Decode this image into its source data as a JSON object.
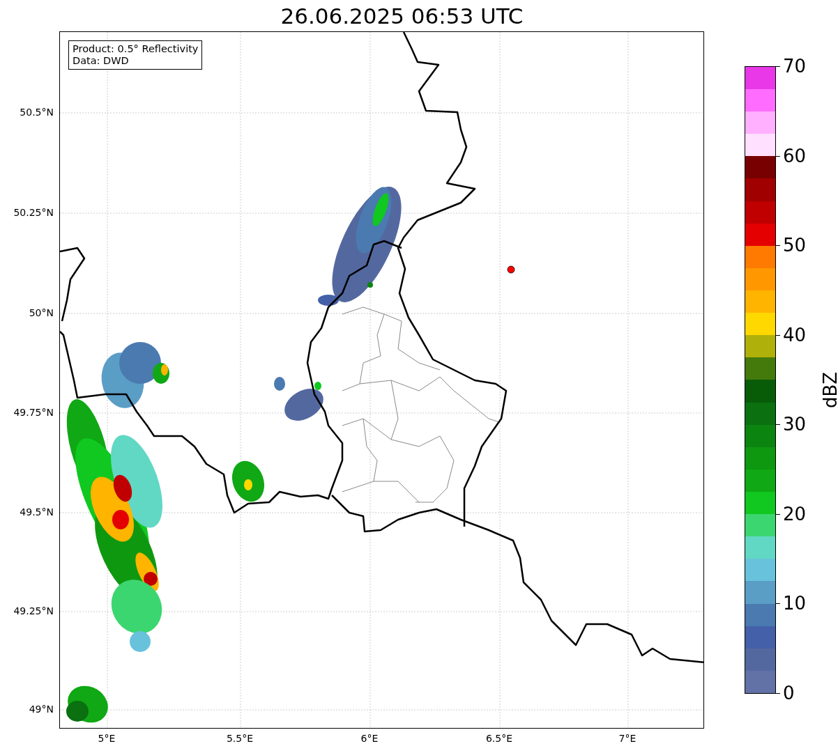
{
  "title": "26.06.2025 06:53 UTC",
  "info_box": [
    "Product: 0.5° Reflectivity",
    "Data: DWD"
  ],
  "lat_labels": [
    "50.5°N",
    "50.25°N",
    "50°N",
    "49.75°N",
    "49.5°N",
    "49.25°N",
    "49°N"
  ],
  "lon_labels": [
    "5°E",
    "5.5°E",
    "6°E",
    "6.5°E",
    "7°E"
  ],
  "colorbar": {
    "label": "dBZ",
    "ticks": [
      "70",
      "60",
      "50",
      "40",
      "30",
      "20",
      "10",
      "0"
    ],
    "bins": [
      {
        "color": "#6272a6"
      },
      {
        "color": "#5468a0"
      },
      {
        "color": "#4460a8"
      },
      {
        "color": "#4a7ab0"
      },
      {
        "color": "#5a9ec6"
      },
      {
        "color": "#68c2dc"
      },
      {
        "color": "#60d8c4"
      },
      {
        "color": "#3cd670"
      },
      {
        "color": "#10c820"
      },
      {
        "color": "#10a814"
      },
      {
        "color": "#0e9810"
      },
      {
        "color": "#0c8410"
      },
      {
        "color": "#0a7010"
      },
      {
        "color": "#085c08"
      },
      {
        "color": "#447a0c"
      },
      {
        "color": "#b0b00a"
      },
      {
        "color": "#ffd800"
      },
      {
        "color": "#ffb400"
      },
      {
        "color": "#ff9800"
      },
      {
        "color": "#ff7a00"
      },
      {
        "color": "#e40000"
      },
      {
        "color": "#c00000"
      },
      {
        "color": "#a00000"
      },
      {
        "color": "#780000"
      },
      {
        "color": "#ffe0ff"
      },
      {
        "color": "#ffb0ff"
      },
      {
        "color": "#ff6cff"
      },
      {
        "color": "#e838e8"
      }
    ]
  }
}
